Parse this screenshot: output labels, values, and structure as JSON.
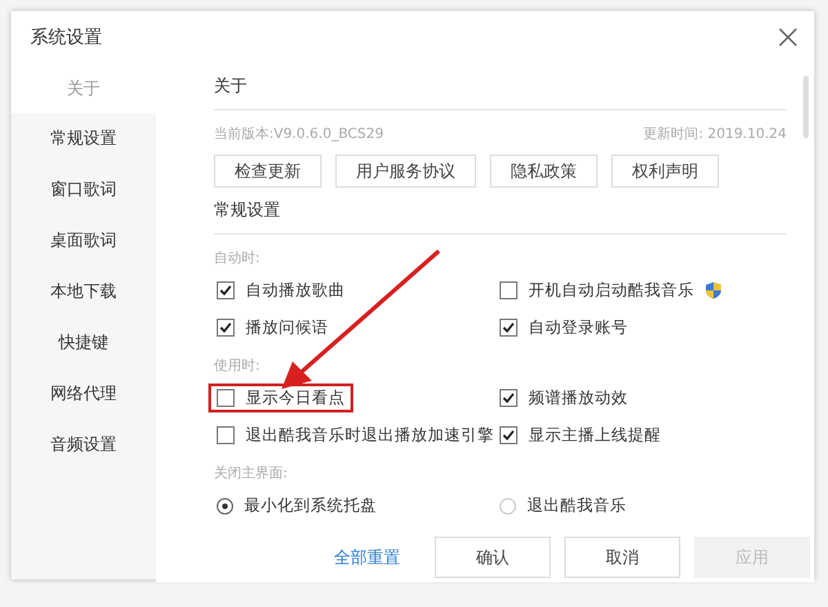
{
  "window": {
    "title": "系统设置"
  },
  "sidebar": {
    "items": [
      {
        "label": "关于",
        "selected": true
      },
      {
        "label": "常规设置",
        "selected": false
      },
      {
        "label": "窗口歌词",
        "selected": false
      },
      {
        "label": "桌面歌词",
        "selected": false
      },
      {
        "label": "本地下载",
        "selected": false
      },
      {
        "label": "快捷键",
        "selected": false
      },
      {
        "label": "网络代理",
        "selected": false
      },
      {
        "label": "音频设置",
        "selected": false
      }
    ]
  },
  "about": {
    "heading": "关于",
    "version": "当前版本:V9.0.6.0_BCS29",
    "updated": "更新时间: 2019.10.24",
    "buttons": [
      "检查更新",
      "用户服务协议",
      "隐私政策",
      "权利声明"
    ]
  },
  "general": {
    "heading": "常规设置",
    "groups": [
      {
        "label": "自动时:",
        "options": [
          {
            "kind": "checkbox",
            "label": "自动播放歌曲",
            "checked": true,
            "highlighted": false,
            "shield_icon": false
          },
          {
            "kind": "checkbox",
            "label": "开机自动启动酷我音乐",
            "checked": false,
            "highlighted": false,
            "shield_icon": true
          },
          {
            "kind": "checkbox",
            "label": "播放问候语",
            "checked": true,
            "highlighted": false,
            "shield_icon": false
          },
          {
            "kind": "checkbox",
            "label": "自动登录账号",
            "checked": true,
            "highlighted": false,
            "shield_icon": false
          }
        ]
      },
      {
        "label": "使用时:",
        "options": [
          {
            "kind": "checkbox",
            "label": "显示今日看点",
            "checked": false,
            "highlighted": true,
            "shield_icon": false
          },
          {
            "kind": "checkbox",
            "label": "频谱播放动效",
            "checked": true,
            "highlighted": false,
            "shield_icon": false
          },
          {
            "kind": "checkbox",
            "label": "退出酷我音乐时退出播放加速引擎",
            "checked": false,
            "highlighted": false,
            "shield_icon": false
          },
          {
            "kind": "checkbox",
            "label": "显示主播上线提醒",
            "checked": true,
            "highlighted": false,
            "shield_icon": false
          }
        ]
      },
      {
        "label": "关闭主界面:",
        "options": [
          {
            "kind": "radio",
            "label": "最小化到系统托盘",
            "selected": true,
            "highlighted": false,
            "shield_icon": false
          },
          {
            "kind": "radio",
            "label": "退出酷我音乐",
            "selected": false,
            "highlighted": false,
            "shield_icon": false
          }
        ]
      }
    ]
  },
  "footer": {
    "reset_link": "全部重置",
    "buttons": [
      {
        "label": "确认",
        "disabled": false
      },
      {
        "label": "取消",
        "disabled": false
      },
      {
        "label": "应用",
        "disabled": true
      }
    ]
  }
}
